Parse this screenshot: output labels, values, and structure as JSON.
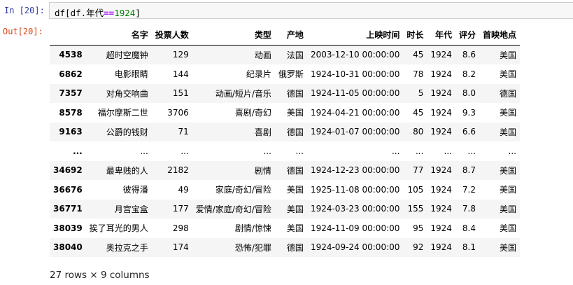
{
  "input_prompt": "In  [20]:",
  "output_prompt": "Out[20]:",
  "code": {
    "prefix": "df[df.年代",
    "operator": "==",
    "number": "1924",
    "suffix": "]"
  },
  "table": {
    "columns": [
      "",
      "名字",
      "投票人数",
      "类型",
      "产地",
      "上映时间",
      "时长",
      "年代",
      "评分",
      "首映地点"
    ],
    "rows": [
      [
        "4538",
        "超时空魔钟",
        "129",
        "动画",
        "法国",
        "2003-12-10 00:00:00",
        "45",
        "1924",
        "8.6",
        "美国"
      ],
      [
        "6862",
        "电影眼睛",
        "144",
        "纪录片",
        "俄罗斯",
        "1924-10-31 00:00:00",
        "78",
        "1924",
        "8.2",
        "美国"
      ],
      [
        "7357",
        "对角交响曲",
        "151",
        "动画/短片/音乐",
        "德国",
        "1924-11-05 00:00:00",
        "5",
        "1924",
        "8.0",
        "德国"
      ],
      [
        "8578",
        "福尔摩斯二世",
        "3706",
        "喜剧/奇幻",
        "美国",
        "1924-04-21 00:00:00",
        "45",
        "1924",
        "9.3",
        "美国"
      ],
      [
        "9163",
        "公爵的钱财",
        "71",
        "喜剧",
        "德国",
        "1924-01-07 00:00:00",
        "80",
        "1924",
        "6.6",
        "美国"
      ],
      [
        "...",
        "...",
        "...",
        "...",
        "...",
        "...",
        "...",
        "...",
        "...",
        "..."
      ],
      [
        "34692",
        "最卑贱的人",
        "2182",
        "剧情",
        "德国",
        "1924-12-23 00:00:00",
        "77",
        "1924",
        "8.7",
        "美国"
      ],
      [
        "36676",
        "彼得潘",
        "49",
        "家庭/奇幻/冒险",
        "美国",
        "1925-11-08 00:00:00",
        "105",
        "1924",
        "7.2",
        "美国"
      ],
      [
        "36771",
        "月宫宝盒",
        "177",
        "爱情/家庭/奇幻/冒险",
        "美国",
        "1924-03-23 00:00:00",
        "155",
        "1924",
        "7.8",
        "美国"
      ],
      [
        "38039",
        "挨了耳光的男人",
        "298",
        "剧情/惊悚",
        "美国",
        "1924-11-09 00:00:00",
        "95",
        "1924",
        "8.4",
        "美国"
      ],
      [
        "38040",
        "奥拉克之手",
        "174",
        "恐怖/犯罪",
        "德国",
        "1924-09-24 00:00:00",
        "92",
        "1924",
        "8.1",
        "美国"
      ]
    ]
  },
  "shape_text": "27 rows × 9 columns"
}
